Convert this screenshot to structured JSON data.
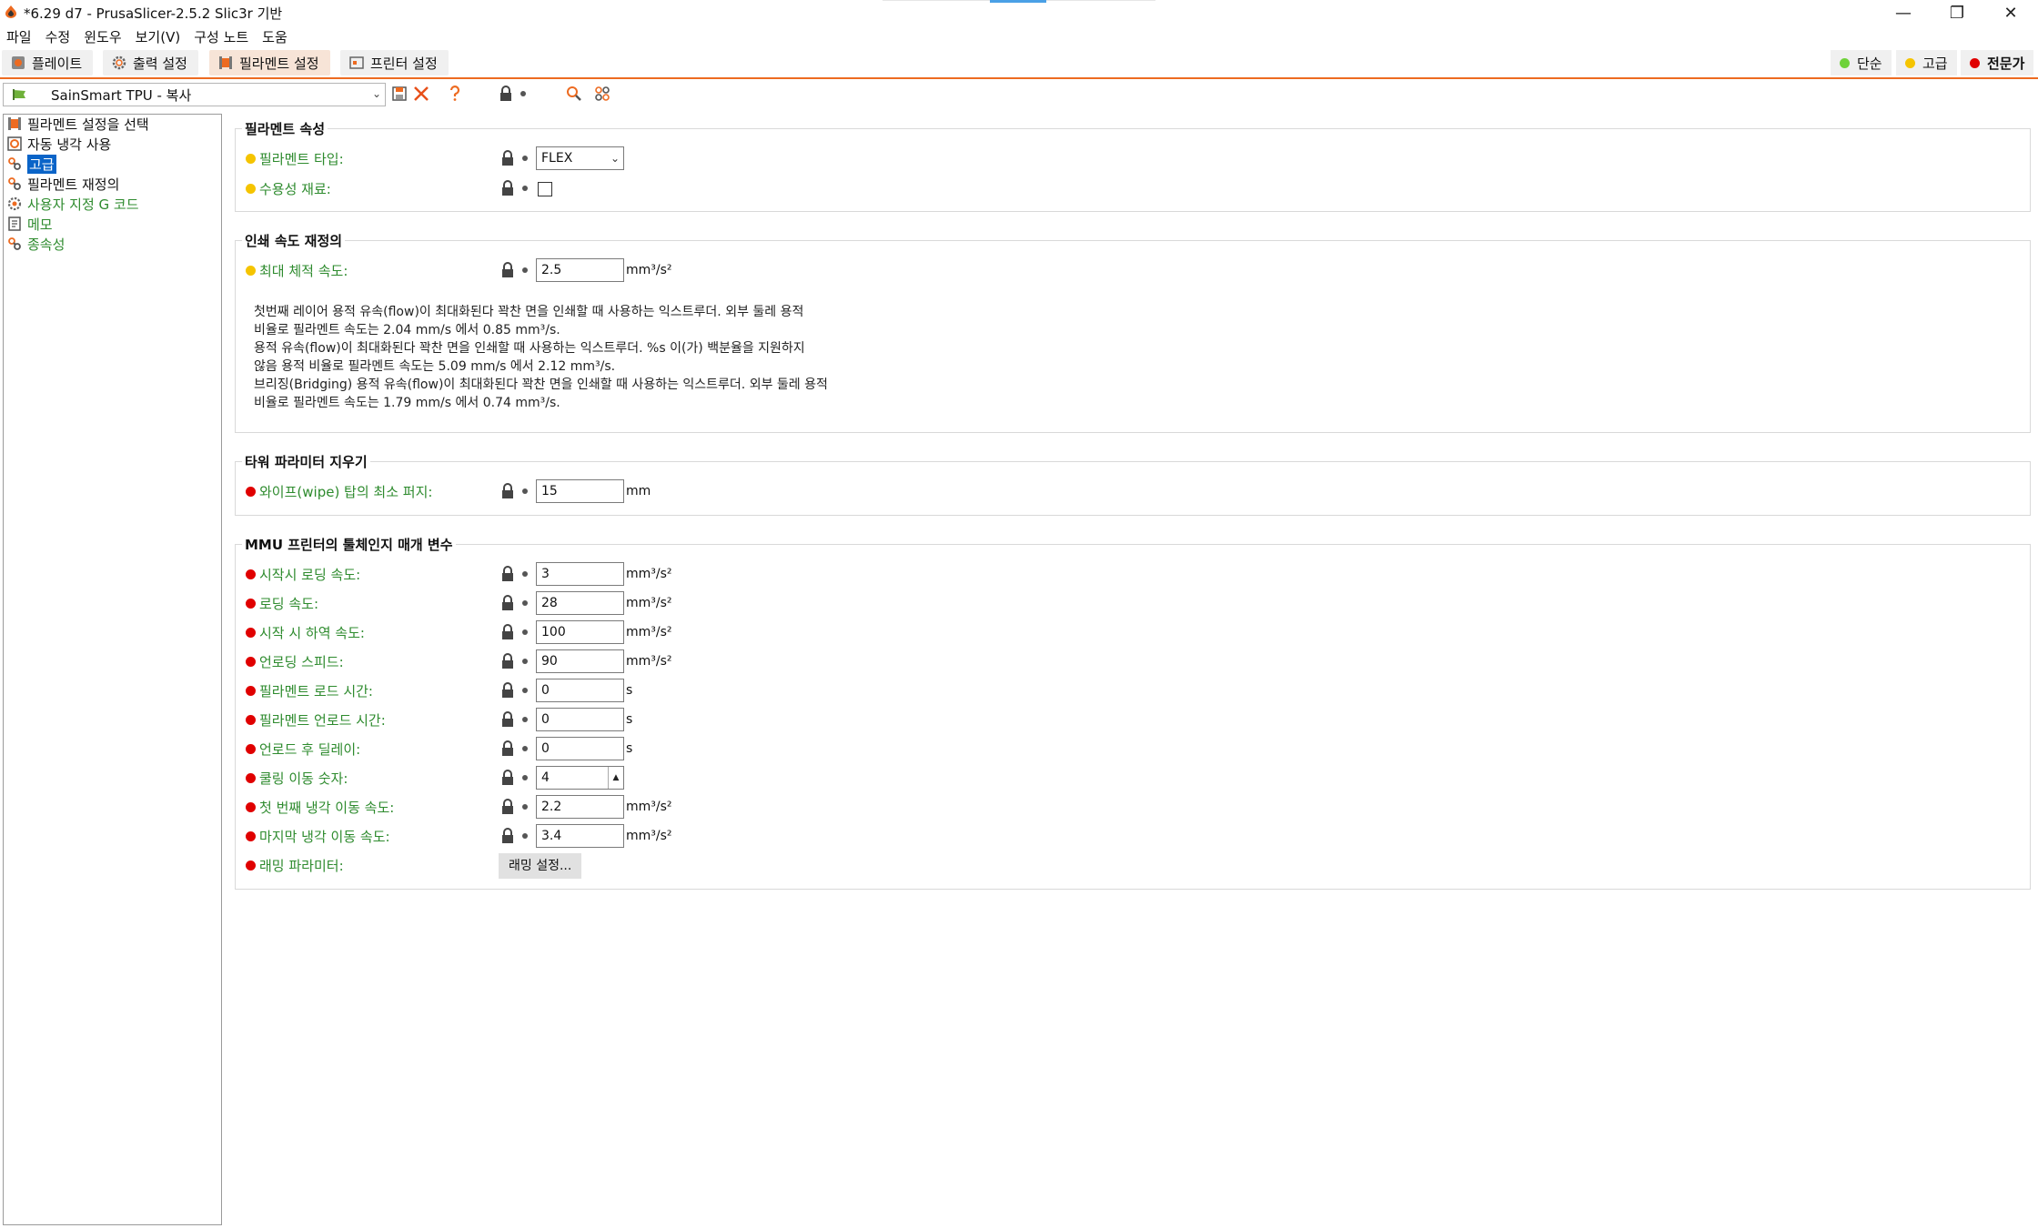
{
  "window": {
    "title": "*6.29 d7 - PrusaSlicer-2.5.2 Slic3r 기반",
    "minimize": "—",
    "maximize": "❐",
    "close": "✕"
  },
  "menu": [
    {
      "label": "파일",
      "accel": "F"
    },
    {
      "label": "수정",
      "accel": "E"
    },
    {
      "label": "윈도우",
      "accel": "W"
    },
    {
      "label": "보기(V)",
      "accel": "V"
    },
    {
      "label": "구성 노트",
      "accel": "C"
    },
    {
      "label": "도움",
      "accel": "H"
    }
  ],
  "tabs": [
    {
      "label": "플레이트",
      "icon": "plater-icon"
    },
    {
      "label": "출력 설정",
      "icon": "gear-icon"
    },
    {
      "label": "필라멘트 설정",
      "icon": "spool-icon",
      "active": true
    },
    {
      "label": "프린터 설정",
      "icon": "printer-icon"
    }
  ],
  "modes": [
    {
      "label": "단순",
      "color": "#6fd23a"
    },
    {
      "label": "고급",
      "color": "#f5c400"
    },
    {
      "label": "전문가",
      "color": "#e00000",
      "active": true
    }
  ],
  "preset": {
    "name": "SainSmart TPU - 복사"
  },
  "sidebar": {
    "items": [
      {
        "label": "필라멘트 설정을 선택",
        "icon": "spool-icon",
        "style": "normal"
      },
      {
        "label": "자동 냉각 사용",
        "icon": "cooling-icon",
        "style": "normal"
      },
      {
        "label": "고급",
        "icon": "wrench-icon",
        "style": "selected"
      },
      {
        "label": "필라멘트 재정의",
        "icon": "wrench-icon",
        "style": "normal"
      },
      {
        "label": "사용자 지정 G 코드",
        "icon": "gcode-icon",
        "style": "green"
      },
      {
        "label": "메모",
        "icon": "note-icon",
        "style": "green"
      },
      {
        "label": "종속성",
        "icon": "wrench-icon",
        "style": "green"
      }
    ]
  },
  "groups": {
    "filament_props": {
      "title": "필라멘트 속성",
      "type_label": "필라멘트 타입:",
      "type_value": "FLEX",
      "soluble_label": "수용성 재료:"
    },
    "print_speed": {
      "title": "인쇄 속도 재정의",
      "max_vol_label": "최대 체적 속도:",
      "max_vol_value": "2.5",
      "max_vol_unit": "mm³/s²",
      "desc": [
        "첫번째 레이어 용적 유속(flow)이 최대화된다 꽉찬 면을 인쇄할 때 사용하는 익스트루더. 외부 둘레 용적",
        "비율로 필라멘트 속도는 2.04 mm/s 에서 0.85 mm³/s.",
        "용적 유속(flow)이 최대화된다 꽉찬 면을 인쇄할 때 사용하는 익스트루더. %s 이(가) 백분율을 지원하지",
        "않음 용적 비율로 필라멘트 속도는 5.09 mm/s 에서 2.12 mm³/s.",
        "브리징(Bridging) 용적 유속(flow)이 최대화된다 꽉찬 면을 인쇄할 때 사용하는 익스트루더. 외부 둘레 용적",
        "비율로 필라멘트 속도는 1.79 mm/s 에서 0.74 mm³/s."
      ]
    },
    "wipe_tower": {
      "title": "타워 파라미터 지우기",
      "purge_label": "와이프(wipe) 탑의 최소 퍼지:",
      "purge_value": "15",
      "purge_unit": "mm"
    },
    "mmu": {
      "title": "MMU 프린터의 툴체인지 매개 변수",
      "rows": [
        {
          "label": "시작시 로딩 속도:",
          "value": "3",
          "unit": "mm³/s²"
        },
        {
          "label": "로딩 속도:",
          "value": "28",
          "unit": "mm³/s²"
        },
        {
          "label": "시작 시 하역 속도:",
          "value": "100",
          "unit": "mm³/s²"
        },
        {
          "label": "언로딩 스피드:",
          "value": "90",
          "unit": "mm³/s²"
        },
        {
          "label": "필라멘트 로드 시간:",
          "value": "0",
          "unit": "s"
        },
        {
          "label": "필라멘트 언로드 시간:",
          "value": "0",
          "unit": "s"
        },
        {
          "label": "언로드 후 딜레이:",
          "value": "0",
          "unit": "s"
        },
        {
          "label": "쿨링 이동 숫자:",
          "value": "4",
          "unit": ""
        },
        {
          "label": "첫 번째 냉각 이동 속도:",
          "value": "2.2",
          "unit": "mm³/s²"
        },
        {
          "label": "마지막 냉각 이동 속도:",
          "value": "3.4",
          "unit": "mm³/s²"
        }
      ],
      "ramming_label": "래밍 파라미터:",
      "ramming_button": "래밍 설정..."
    }
  },
  "colors": {
    "accent": "#ed6b21",
    "advanced": "#f5c400",
    "expert": "#e00000",
    "simple": "#6fd23a",
    "selection": "#0a64c8"
  }
}
